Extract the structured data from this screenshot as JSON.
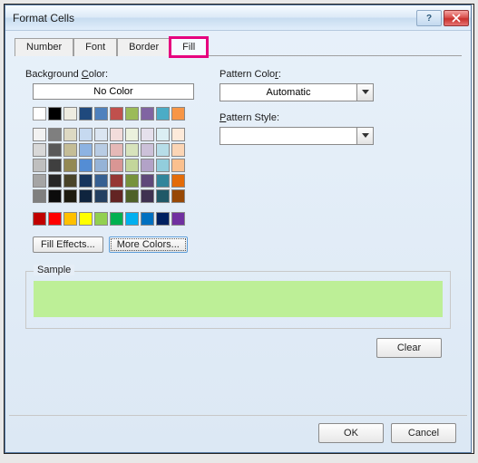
{
  "window": {
    "title": "Format Cells"
  },
  "tabs": [
    {
      "label": "Number"
    },
    {
      "label": "Font"
    },
    {
      "label": "Border"
    },
    {
      "label": "Fill"
    }
  ],
  "fill": {
    "bg_label_pre": "Background ",
    "bg_label_ul": "C",
    "bg_label_post": "olor:",
    "no_color": "No Color",
    "fill_effects": "Fill Effects...",
    "more_colors": "More Colors...",
    "pattern_color_label": "Pattern Color:",
    "pattern_color_ul": "A",
    "pattern_color_value": "Automatic",
    "pattern_style_ul": "P",
    "pattern_style_label": "attern Style:",
    "sample_label": "Sample",
    "sample_color": "#bdef97",
    "clear": "Clear"
  },
  "buttons": {
    "ok": "OK",
    "cancel": "Cancel"
  },
  "palette": {
    "top": [
      "#ffffff",
      "#000000",
      "#eeece1",
      "#1f497d",
      "#4f81bd",
      "#c0504d",
      "#9bbb59",
      "#8064a2",
      "#4bacc6",
      "#f79646"
    ],
    "grid": [
      [
        "#f2f2f2",
        "#7f7f7f",
        "#ddd9c3",
        "#c6d9f0",
        "#dbe5f1",
        "#f2dcdb",
        "#ebf1dd",
        "#e5e0ec",
        "#dbeef3",
        "#fdeada"
      ],
      [
        "#d8d8d8",
        "#595959",
        "#c4bd97",
        "#8db3e2",
        "#b8cce4",
        "#e5b9b7",
        "#d7e3bc",
        "#ccc1d9",
        "#b7dde8",
        "#fbd5b5"
      ],
      [
        "#bfbfbf",
        "#3f3f3f",
        "#938953",
        "#548dd4",
        "#95b3d7",
        "#d99694",
        "#c3d69b",
        "#b2a2c7",
        "#92cddc",
        "#fac08f"
      ],
      [
        "#a5a5a5",
        "#262626",
        "#494429",
        "#17365d",
        "#366092",
        "#953734",
        "#76923c",
        "#5f497a",
        "#31859b",
        "#e36c09"
      ],
      [
        "#7f7f7f",
        "#0c0c0c",
        "#1d1b10",
        "#0f243e",
        "#244061",
        "#632423",
        "#4f6128",
        "#3f3151",
        "#205867",
        "#974806"
      ]
    ],
    "standard": [
      "#c00000",
      "#ff0000",
      "#ffc000",
      "#ffff00",
      "#92d050",
      "#00b050",
      "#00b0f0",
      "#0070c0",
      "#002060",
      "#7030a0"
    ]
  }
}
